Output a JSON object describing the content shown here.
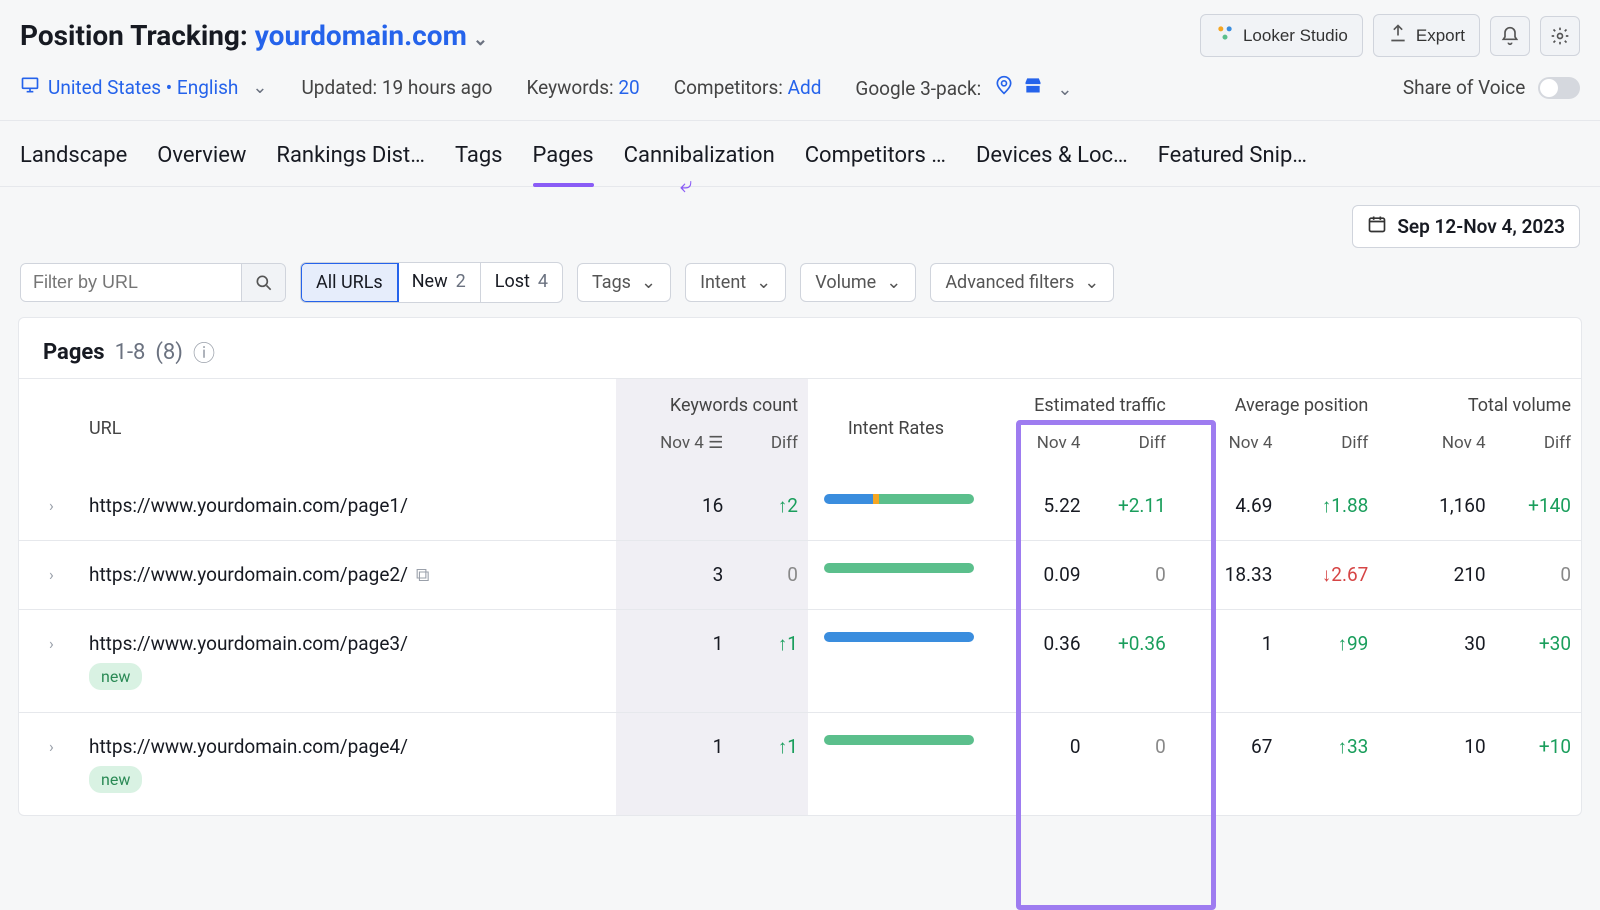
{
  "header": {
    "title_prefix": "Position Tracking: ",
    "domain": "yourdomain.com",
    "looker": "Looker Studio",
    "export": "Export"
  },
  "subbar": {
    "locale": "United States • English",
    "updated": "Updated: 19 hours ago",
    "keywords_label": "Keywords: ",
    "keywords_value": "20",
    "competitors_label": "Competitors: ",
    "competitors_value": "Add",
    "g3_label": "Google 3-pack:",
    "share_label": "Share of Voice"
  },
  "tabs": [
    "Landscape",
    "Overview",
    "Rankings Dist…",
    "Tags",
    "Pages",
    "Cannibalization",
    "Competitors …",
    "Devices & Loc…",
    "Featured Snip…"
  ],
  "active_tab": 4,
  "date_range": "Sep 12-Nov 4, 2023",
  "filters": {
    "url_placeholder": "Filter by URL",
    "seg": [
      {
        "label": "All URLs",
        "count": ""
      },
      {
        "label": "New",
        "count": "2"
      },
      {
        "label": "Lost",
        "count": "4"
      }
    ],
    "tags": "Tags",
    "intent": "Intent",
    "volume": "Volume",
    "advanced": "Advanced filters"
  },
  "card": {
    "title": "Pages",
    "range": "1-8",
    "total": "(8)"
  },
  "cols": {
    "url": "URL",
    "kc": "Keywords count",
    "intent": "Intent Rates",
    "et": "Estimated traffic",
    "ap": "Average position",
    "tv": "Total volume",
    "date": "Nov 4",
    "diff": "Diff"
  },
  "rows": [
    {
      "url": "https://www.yourdomain.com/page1/",
      "new": false,
      "ext": false,
      "kc": "16",
      "kc_diff": "↑2",
      "kc_cls": "pos",
      "intent": [
        33,
        4,
        63
      ],
      "et": "5.22",
      "et_diff": "+2.11",
      "et_cls": "pos",
      "ap": "4.69",
      "ap_diff": "↑1.88",
      "ap_cls": "pos",
      "tv": "1,160",
      "tv_diff": "+140",
      "tv_cls": "pos"
    },
    {
      "url": "https://www.yourdomain.com/page2/",
      "new": false,
      "ext": true,
      "kc": "3",
      "kc_diff": "0",
      "kc_cls": "zero",
      "intent": [
        0,
        0,
        100
      ],
      "et": "0.09",
      "et_diff": "0",
      "et_cls": "zero",
      "ap": "18.33",
      "ap_diff": "↓2.67",
      "ap_cls": "neg",
      "tv": "210",
      "tv_diff": "0",
      "tv_cls": "zero"
    },
    {
      "url": "https://www.yourdomain.com/page3/",
      "new": true,
      "ext": false,
      "kc": "1",
      "kc_diff": "↑1",
      "kc_cls": "pos",
      "intent": [
        100,
        0,
        0
      ],
      "et": "0.36",
      "et_diff": "+0.36",
      "et_cls": "pos",
      "ap": "1",
      "ap_diff": "↑99",
      "ap_cls": "pos",
      "tv": "30",
      "tv_diff": "+30",
      "tv_cls": "pos"
    },
    {
      "url": "https://www.yourdomain.com/page4/",
      "new": true,
      "ext": false,
      "kc": "1",
      "kc_diff": "↑1",
      "kc_cls": "pos",
      "intent": [
        0,
        0,
        100
      ],
      "et": "0",
      "et_diff": "0",
      "et_cls": "zero",
      "ap": "67",
      "ap_diff": "↑33",
      "ap_cls": "pos",
      "tv": "10",
      "tv_diff": "+10",
      "tv_cls": "pos"
    }
  ],
  "new_label": "new"
}
